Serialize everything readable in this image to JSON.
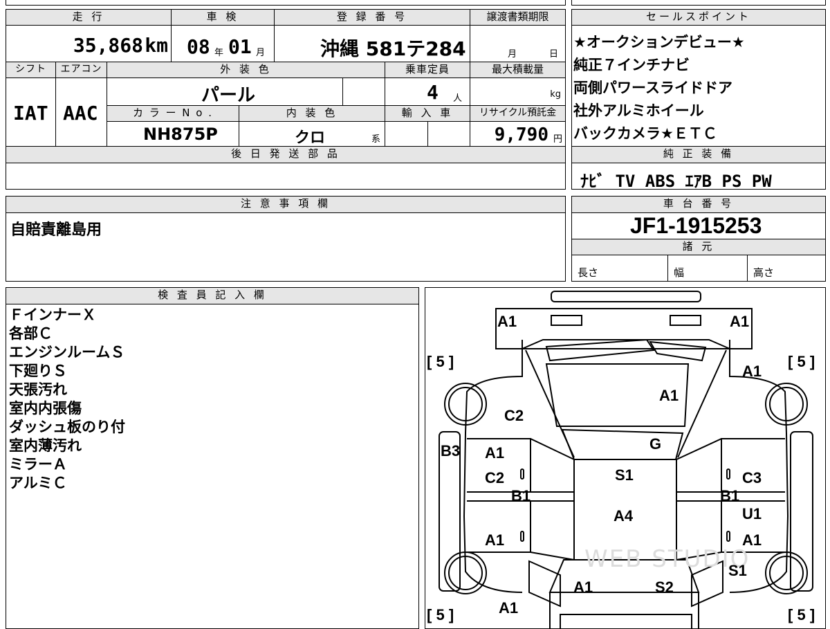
{
  "header": {
    "mileage_label": "走 行",
    "mileage_value": "35,868",
    "mileage_unit": "km",
    "inspection_label": "車 検",
    "inspection_year": "08",
    "inspection_year_unit": "年",
    "inspection_month": "01",
    "inspection_month_unit": "月",
    "registration_label": "登 録 番 号",
    "registration_value": "沖縄 581テ284",
    "transfer_label": "譲渡書類期限",
    "transfer_month": "月",
    "transfer_day": "日",
    "shift_label": "シフト",
    "shift_value": "IAT",
    "ac_label": "エアコン",
    "ac_value": "AAC",
    "exterior_color_label": "外 装 色",
    "exterior_color_value": "パール",
    "capacity_label": "乗車定員",
    "capacity_value": "4",
    "capacity_unit": "人",
    "max_load_label": "最大積載量",
    "max_load_unit": "kg",
    "color_no_label": "カ ラ ー N o .",
    "color_no_value": "NH875P",
    "interior_color_label": "内 装 色",
    "interior_color_value": "クロ",
    "interior_color_suffix": "系",
    "import_label": "輸 入 車",
    "recycle_label": "リサイクル預託金",
    "recycle_value": "9,790",
    "recycle_unit": "円",
    "later_parts_label": "後 日 発 送 部 品"
  },
  "sales_points": {
    "label": "セールスポイント",
    "lines": [
      "★オークションデビュー★",
      "純正７インチナビ",
      "両側パワースライドドア",
      "社外アルミホイール",
      "バックカメラ★ＥＴＣ"
    ]
  },
  "equipment": {
    "label": "純 正 装 備",
    "value": "ﾅﾋﾞ TV ABS ｴｱB PS PW"
  },
  "notes": {
    "label": "注 意 事 項 欄",
    "value": "自賠責離島用"
  },
  "chassis": {
    "label": "車 台 番 号",
    "value": "JF1-1915253",
    "spec_label": "諸 元",
    "length_label": "長さ",
    "width_label": "幅",
    "height_label": "高さ"
  },
  "inspector": {
    "label": "検 査 員 記 入 欄",
    "lines": [
      "ＦインナーＸ",
      "各部Ｃ",
      "エンジンルームＳ",
      "下廻りＳ",
      "天張汚れ",
      "室内内張傷",
      "ダッシュ板のり付",
      "室内薄汚れ",
      "ミラーＡ",
      "アルミＣ"
    ]
  },
  "diagram": {
    "watermark": "WEB STUDIO",
    "marks": {
      "front_left_top": "A1",
      "front_right_top": "A1",
      "tire_fl": "5",
      "tire_fr": "5",
      "tire_rl": "5",
      "tire_rr": "5",
      "fender_right_front": "A1",
      "hood": "A1",
      "fender_left_front": "C2",
      "windshield": "G",
      "left_side": "B3",
      "left_front_door_top": "A1",
      "left_front_door": "C2",
      "left_pillar": "B1",
      "left_rear_door": "A1",
      "roof_front": "S1",
      "roof_rear": "A4",
      "right_front_door": "C3",
      "right_pillar": "B1",
      "right_rear_upper": "U1",
      "right_rear_door": "A1",
      "right_quarter": "S1",
      "rear_left": "A1",
      "rear_right": "S2",
      "rear_bottom_left": "A1"
    }
  }
}
